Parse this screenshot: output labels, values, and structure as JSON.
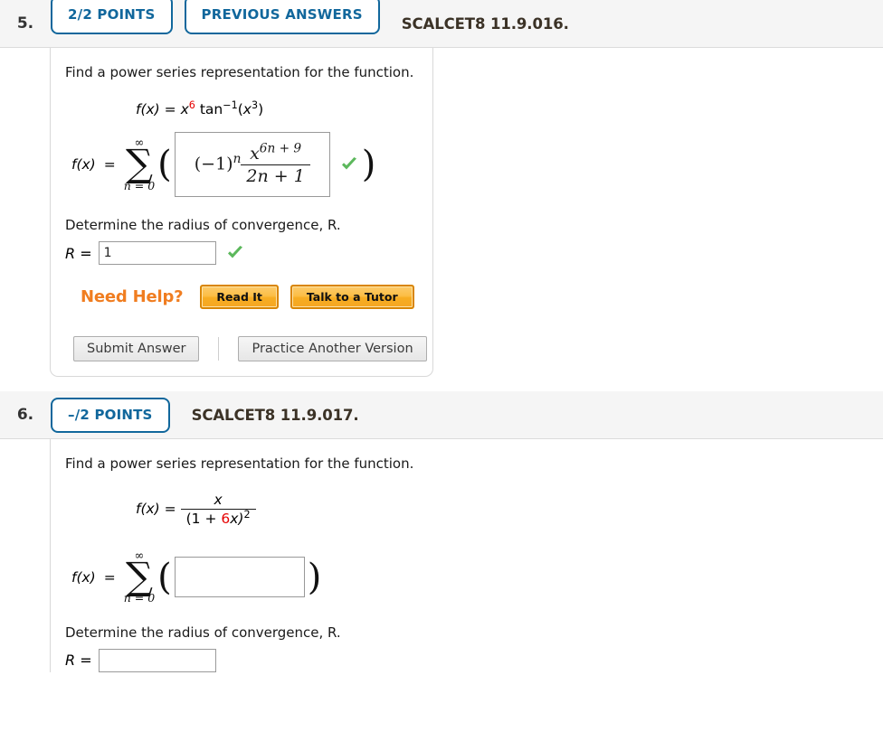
{
  "page": {
    "accent_blue": "#11679c",
    "accent_orange": "#f07d20",
    "check_green": "#5cb85c",
    "math_red": "#e60000"
  },
  "questions": [
    {
      "number": "5.",
      "points_badge": "2/2 POINTS",
      "previous_answers_badge": "PREVIOUS ANSWERS",
      "code": "SCALCET8 11.9.016.",
      "prompt": "Find a power series representation for the function.",
      "function": {
        "lhs": "f(x)",
        "eq": "=",
        "base": "x",
        "base_exp": "6",
        "trig": "tan",
        "trig_exp": "−1",
        "arg_open": "(",
        "arg": "x",
        "arg_exp": "3",
        "arg_close": ")"
      },
      "series": {
        "lhs": "f(x)",
        "eq": "=",
        "sigma": "∑",
        "upper": "∞",
        "lower": "n = 0",
        "paren_open": "(",
        "paren_close": ")",
        "answer_sign": "(−1)",
        "answer_sign_exp": "n",
        "answer_num_base": "x",
        "answer_num_exp": "6n + 9",
        "answer_den": "2n + 1",
        "answer_correct": true
      },
      "radius": {
        "prompt": "Determine the radius of convergence, R.",
        "label": "R =",
        "value": "1",
        "placeholder": "",
        "correct": true
      },
      "need_help": {
        "label": "Need Help?",
        "buttons": [
          "Read It",
          "Talk to a Tutor"
        ]
      },
      "actions": [
        "Submit Answer",
        "Practice Another Version"
      ]
    },
    {
      "number": "6.",
      "points_badge": "–/2 POINTS",
      "previous_answers_badge": null,
      "code": "SCALCET8 11.9.017.",
      "prompt": "Find a power series representation for the function.",
      "function": {
        "lhs": "f(x)",
        "eq": "=",
        "numerator": "x",
        "den_open": "(1 + ",
        "den_coeff": "6",
        "den_var": "x)",
        "den_exp": "2"
      },
      "series": {
        "lhs": "f(x)",
        "eq": "=",
        "sigma": "∑",
        "upper": "∞",
        "lower": "n = 0",
        "paren_open": "(",
        "paren_close": ")",
        "answer_value": "",
        "answer_correct": false
      },
      "radius": {
        "prompt": "Determine the radius of convergence, R.",
        "label": "R =",
        "value": "",
        "placeholder": "",
        "correct": false
      }
    }
  ]
}
